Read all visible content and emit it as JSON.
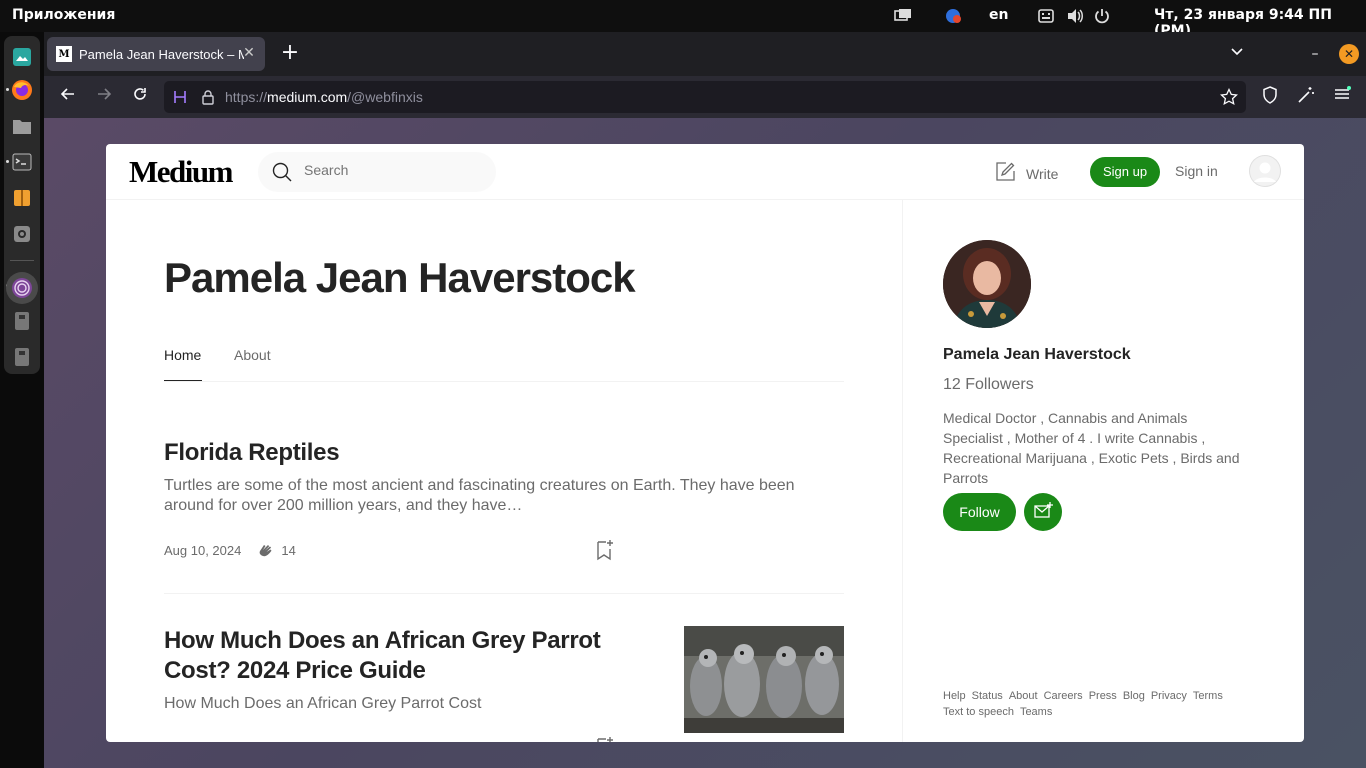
{
  "system": {
    "apps_label": "Приложения",
    "language": "en",
    "clock": "Чт, 23 января  9:44 ПП (PM)"
  },
  "dock": {
    "items": [
      "photos-icon",
      "firefox-icon",
      "files-icon",
      "terminal-icon",
      "archive-icon",
      "settings-icon",
      "tor-icon",
      "usb-icon",
      "usb-icon-2"
    ]
  },
  "browser": {
    "tab_title": "Pamela Jean Haverstock – Medium",
    "tab_favicon": "M",
    "url_scheme": "https://",
    "url_host": "medium.com",
    "url_path": "/@webfinxis"
  },
  "header": {
    "logo": "Medium",
    "search_placeholder": "Search",
    "write_label": "Write",
    "signup_label": "Sign up",
    "signin_label": "Sign in"
  },
  "profile": {
    "name": "Pamela Jean Haverstock",
    "tabs": [
      {
        "label": "Home"
      },
      {
        "label": "About"
      }
    ]
  },
  "posts": [
    {
      "title": "Florida Reptiles",
      "subtitle": "Turtles are some of the most ancient and fascinating creatures on Earth. They have been around for over 200 million years, and they have…",
      "date": "Aug 10, 2024",
      "claps": "14"
    },
    {
      "title": "How Much Does an African Grey Parrot Cost? 2024 Price Guide",
      "subtitle": "How Much Does an African Grey Parrot Cost"
    }
  ],
  "sidebar": {
    "name": "Pamela Jean Haverstock",
    "followers": "12 Followers",
    "bio": "Medical Doctor , Cannabis and Animals Specialist , Mother of 4 . I write Cannabis , Recreational Marijuana , Exotic Pets , Birds and Parrots",
    "follow_label": "Follow",
    "footer": [
      "Help",
      "Status",
      "About",
      "Careers",
      "Press",
      "Blog",
      "Privacy",
      "Terms",
      "Text to speech",
      "Teams"
    ]
  },
  "colors": {
    "accent": "#1a8917",
    "text": "#242424",
    "muted": "#6b6b6b"
  }
}
